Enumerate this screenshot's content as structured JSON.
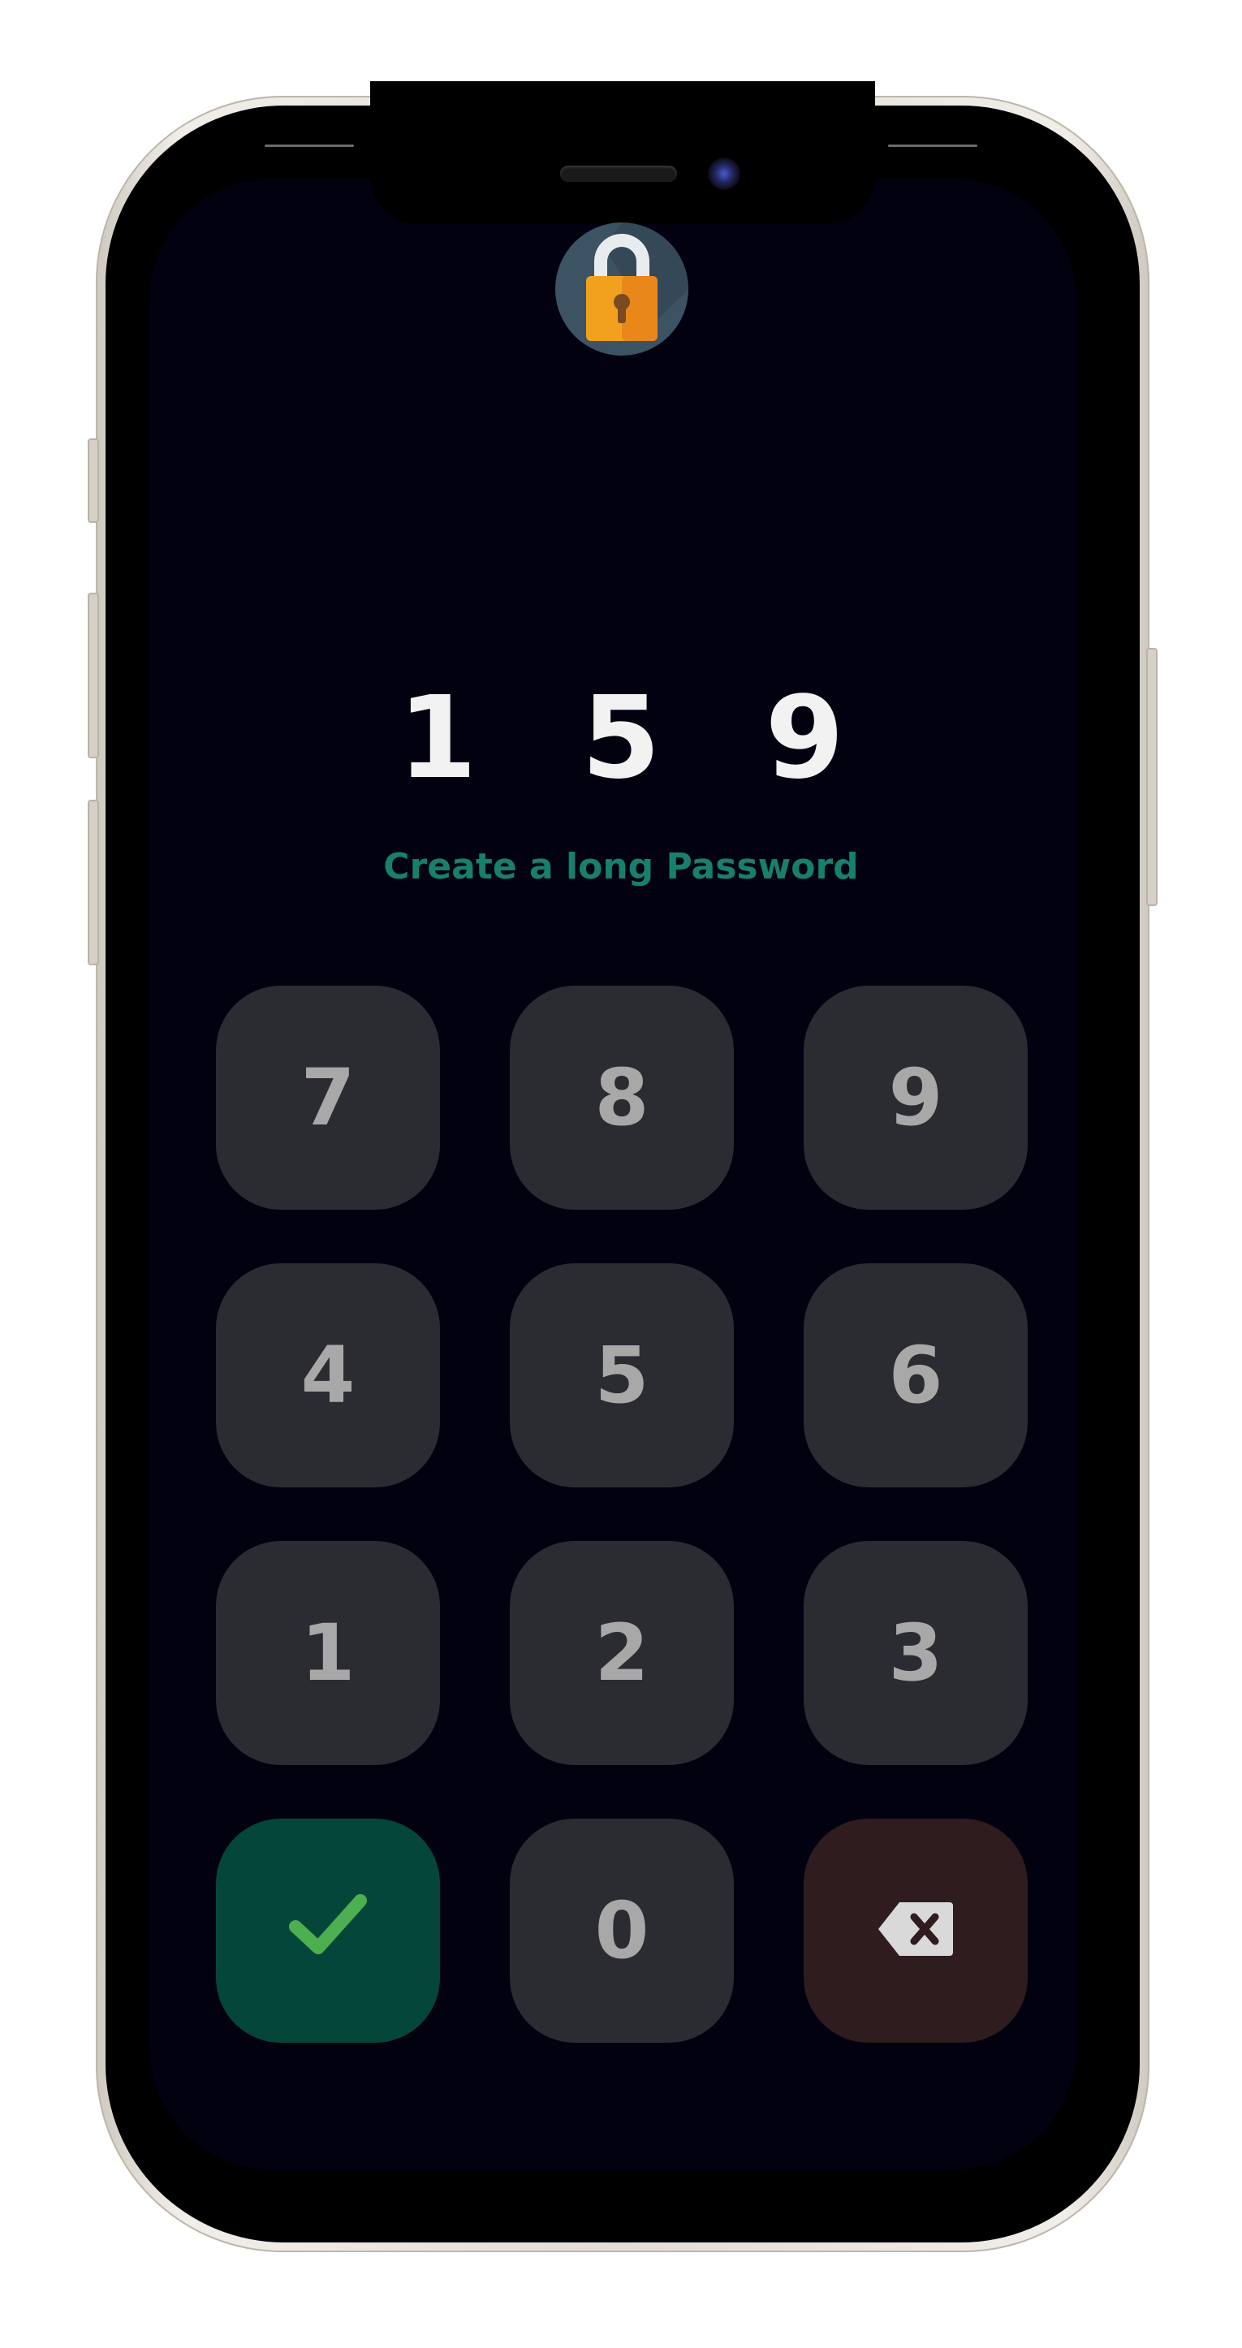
{
  "pin": {
    "digits": [
      "1",
      "5",
      "9"
    ]
  },
  "prompt": "Create a long Password",
  "keypad": {
    "keys": [
      {
        "label": "7",
        "type": "digit"
      },
      {
        "label": "8",
        "type": "digit"
      },
      {
        "label": "9",
        "type": "digit"
      },
      {
        "label": "4",
        "type": "digit"
      },
      {
        "label": "5",
        "type": "digit"
      },
      {
        "label": "6",
        "type": "digit"
      },
      {
        "label": "1",
        "type": "digit"
      },
      {
        "label": "2",
        "type": "digit"
      },
      {
        "label": "3",
        "type": "digit"
      },
      {
        "icon": "check-icon",
        "type": "confirm"
      },
      {
        "label": "0",
        "type": "digit"
      },
      {
        "icon": "backspace-icon",
        "type": "delete"
      }
    ]
  },
  "colors": {
    "screen_background": "#02010f",
    "key_background": "#2b2b32",
    "confirm_background": "#04473a",
    "confirm_icon": "#4caf50",
    "delete_background": "#2e1c1e",
    "delete_icon": "#d9d9d9",
    "prompt_text": "#17806c",
    "pin_text": "#f2f2f2",
    "key_text": "#a8a8a8"
  },
  "icons": {
    "top": "padlock-icon"
  }
}
